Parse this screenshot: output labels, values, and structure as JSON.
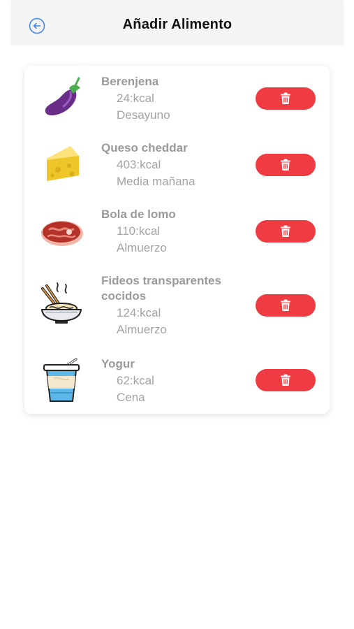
{
  "header": {
    "title": "Añadir Alimento"
  },
  "items": [
    {
      "name": "Berenjena",
      "kcal": "24:kcal",
      "meal": "Desayuno",
      "icon": "eggplant-icon"
    },
    {
      "name": "Queso cheddar",
      "kcal": "403:kcal",
      "meal": "Media mañana",
      "icon": "cheese-icon"
    },
    {
      "name": "Bola de lomo",
      "kcal": "110:kcal",
      "meal": "Almuerzo",
      "icon": "meat-icon"
    },
    {
      "name": "Fideos transparentes cocidos",
      "kcal": "124:kcal",
      "meal": "Almuerzo",
      "icon": "noodles-icon"
    },
    {
      "name": "Yogur",
      "kcal": "62:kcal",
      "meal": "Cena",
      "icon": "yogurt-icon"
    }
  ],
  "colors": {
    "delete_button": "#ef3b42",
    "back_icon": "#3b82f6",
    "text_muted": "#9a9a9a"
  }
}
